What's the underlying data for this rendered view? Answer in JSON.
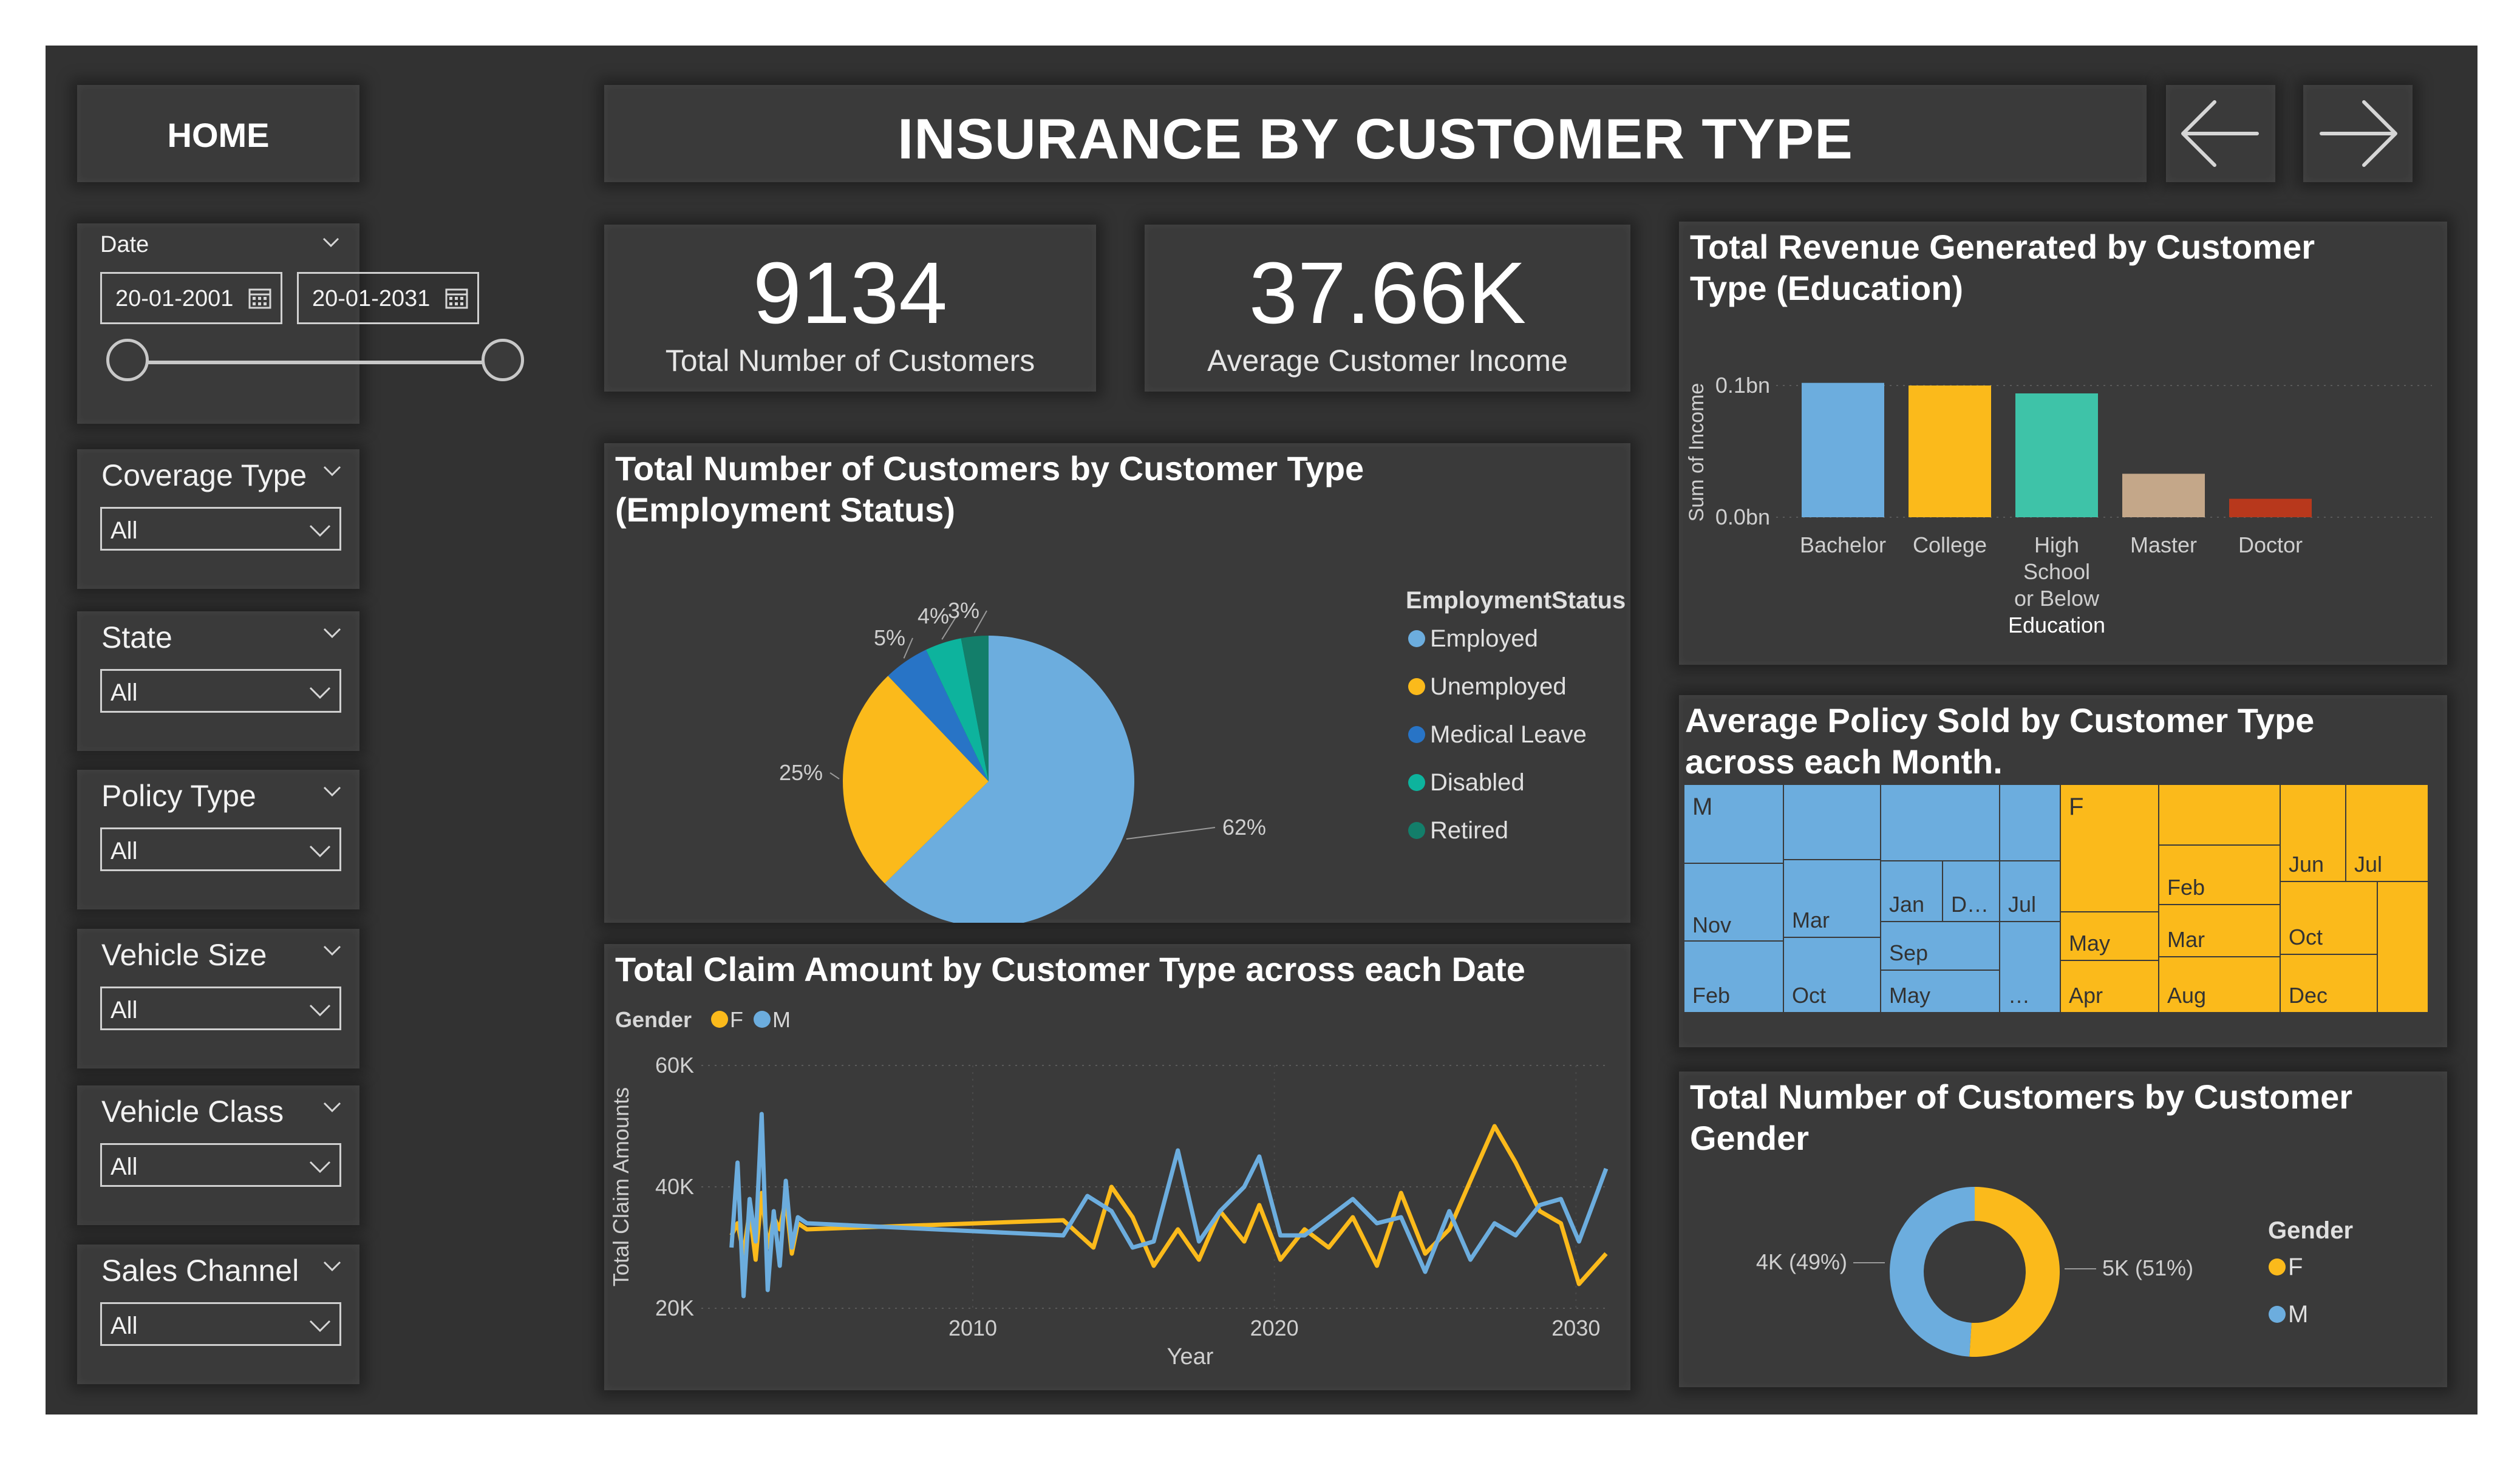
{
  "nav": {
    "home_label": "HOME",
    "title": "INSURANCE BY CUSTOMER TYPE"
  },
  "icons": {
    "back": "arrow-left-icon",
    "forward": "arrow-right-icon",
    "calendar": "calendar-icon",
    "dropdown": "chevron-down-icon"
  },
  "date_slicer": {
    "label": "Date",
    "start": "20-01-2001",
    "end": "20-01-2031"
  },
  "slicers": [
    {
      "label": "Coverage Type",
      "value": "All"
    },
    {
      "label": "State",
      "value": "All"
    },
    {
      "label": "Policy Type",
      "value": "All"
    },
    {
      "label": "Vehicle Size",
      "value": "All"
    },
    {
      "label": "Vehicle Class",
      "value": "All"
    },
    {
      "label": "Sales Channel",
      "value": "All"
    }
  ],
  "kpis": [
    {
      "value": "9134",
      "label": "Total Number of Customers"
    },
    {
      "value": "37.66K",
      "label": "Average Customer Income"
    }
  ],
  "colors": {
    "blue": "#6cadde",
    "yellow": "#fbba1b",
    "dark_blue": "#2874c6",
    "teal": "#0db39d",
    "dark_teal": "#137e6a",
    "tan": "#c4a789",
    "red": "#b8381c",
    "teal_bar": "#3ec3a8",
    "background": "#323232"
  },
  "pie_chart": {
    "title_line1": "Total Number of Customers by Customer Type",
    "title_line2": "(Employment Status)",
    "legend_title": "EmploymentStatus",
    "chart_data": {
      "type": "pie",
      "categories": [
        "Employed",
        "Unemployed",
        "Medical Leave",
        "Disabled",
        "Retired"
      ],
      "values": [
        62,
        25,
        5,
        4,
        3
      ],
      "labels": [
        "62%",
        "25%",
        "5%",
        "4%",
        "3%"
      ]
    }
  },
  "bar_chart": {
    "title_line1": "Total Revenue Generated by Customer",
    "title_line2": "Type (Education)",
    "chart_data": {
      "type": "bar",
      "categories": [
        "Bachelor",
        "College",
        "High School or Below",
        "Master",
        "Doctor"
      ],
      "category_lines": [
        [
          "Bachelor"
        ],
        [
          "College"
        ],
        [
          "High",
          "School",
          "or Below",
          "Education"
        ],
        [
          "Master"
        ],
        [
          "Doctor"
        ]
      ],
      "values": [
        0.102,
        0.1,
        0.094,
        0.033,
        0.014
      ],
      "ylabel": "Sum of Income",
      "yticks": [
        "0.1bn",
        "0.0bn"
      ],
      "ytick_values": [
        0.1,
        0.0
      ]
    }
  },
  "treemap": {
    "title_line1": "Average Policy Sold by Customer Type",
    "title_line2": "across each Month.",
    "chart_data": {
      "type": "treemap",
      "groups": [
        {
          "name": "M",
          "cells": [
            "Nov",
            "Feb",
            "Mar",
            "Oct",
            "Jan",
            "D…",
            "Jul",
            "Sep",
            "May",
            "…"
          ]
        },
        {
          "name": "F",
          "cells": [
            "May",
            "Apr",
            "Feb",
            "Mar",
            "Aug",
            "Jun",
            "Jul",
            "Oct",
            "Dec"
          ]
        }
      ]
    }
  },
  "line_chart": {
    "title": "Total Claim Amount by Customer Type across each Date",
    "legend_title": "Gender",
    "chart_data": {
      "type": "line",
      "xlabel": "Year",
      "ylabel": "Total Claim Amounts",
      "xticks": [
        "2010",
        "2020",
        "2030"
      ],
      "yticks": [
        "60K",
        "40K",
        "20K"
      ],
      "xlim": [
        2001,
        2031
      ],
      "ylim": [
        20000,
        60000
      ],
      "series": [
        {
          "name": "F",
          "points": [
            [
              2002.0,
              32000
            ],
            [
              2002.2,
              34000
            ],
            [
              2002.4,
              29000
            ],
            [
              2002.6,
              36000
            ],
            [
              2002.8,
              28000
            ],
            [
              2003.0,
              39000
            ],
            [
              2003.2,
              30000
            ],
            [
              2003.4,
              35000
            ],
            [
              2003.6,
              33000
            ],
            [
              2003.8,
              38000
            ],
            [
              2004.0,
              29000
            ],
            [
              2004.2,
              34000
            ],
            [
              2004.5,
              33000
            ],
            [
              2013,
              34500
            ],
            [
              2014,
              30000
            ],
            [
              2014.6,
              40000
            ],
            [
              2015.3,
              35000
            ],
            [
              2016,
              27000
            ],
            [
              2016.8,
              33000
            ],
            [
              2017.5,
              28000
            ],
            [
              2018.2,
              36000
            ],
            [
              2019,
              31000
            ],
            [
              2019.5,
              37000
            ],
            [
              2020.2,
              28000
            ],
            [
              2021,
              33000
            ],
            [
              2021.8,
              30000
            ],
            [
              2022.6,
              35000
            ],
            [
              2023.4,
              27000
            ],
            [
              2024.2,
              39000
            ],
            [
              2025,
              29000
            ],
            [
              2025.8,
              33000
            ],
            [
              2026.5,
              41000
            ],
            [
              2027.3,
              50000
            ],
            [
              2028,
              44000
            ],
            [
              2028.8,
              36000
            ],
            [
              2029.5,
              34000
            ],
            [
              2030.1,
              24000
            ],
            [
              2031,
              29000
            ]
          ]
        },
        {
          "name": "M",
          "points": [
            [
              2002.0,
              30000
            ],
            [
              2002.2,
              44000
            ],
            [
              2002.4,
              22000
            ],
            [
              2002.6,
              38000
            ],
            [
              2002.8,
              31000
            ],
            [
              2003.0,
              52000
            ],
            [
              2003.2,
              23000
            ],
            [
              2003.4,
              36000
            ],
            [
              2003.6,
              27000
            ],
            [
              2003.8,
              41000
            ],
            [
              2004.0,
              30000
            ],
            [
              2004.2,
              35000
            ],
            [
              2004.5,
              34000
            ],
            [
              2013,
              32000
            ],
            [
              2013.8,
              38500
            ],
            [
              2014.6,
              36000
            ],
            [
              2015.3,
              30000
            ],
            [
              2016,
              31000
            ],
            [
              2016.8,
              46000
            ],
            [
              2017.5,
              31000
            ],
            [
              2018.2,
              36000
            ],
            [
              2019,
              40000
            ],
            [
              2019.5,
              45000
            ],
            [
              2020.2,
              32000
            ],
            [
              2021,
              32000
            ],
            [
              2021.8,
              35000
            ],
            [
              2022.6,
              38000
            ],
            [
              2023.4,
              34000
            ],
            [
              2024.2,
              35000
            ],
            [
              2025,
              26000
            ],
            [
              2025.8,
              36000
            ],
            [
              2026.5,
              28000
            ],
            [
              2027.3,
              34000
            ],
            [
              2028,
              32000
            ],
            [
              2028.8,
              37000
            ],
            [
              2029.5,
              38000
            ],
            [
              2030.1,
              31000
            ],
            [
              2031,
              43000
            ]
          ]
        }
      ]
    }
  },
  "donut_chart": {
    "title_line1": "Total Number of Customers by Customer",
    "title_line2": "Gender",
    "legend_title": "Gender",
    "chart_data": {
      "type": "pie",
      "categories": [
        "F",
        "M"
      ],
      "values": [
        51,
        49
      ],
      "labels": [
        "5K (51%)",
        "4K (49%)"
      ]
    }
  }
}
